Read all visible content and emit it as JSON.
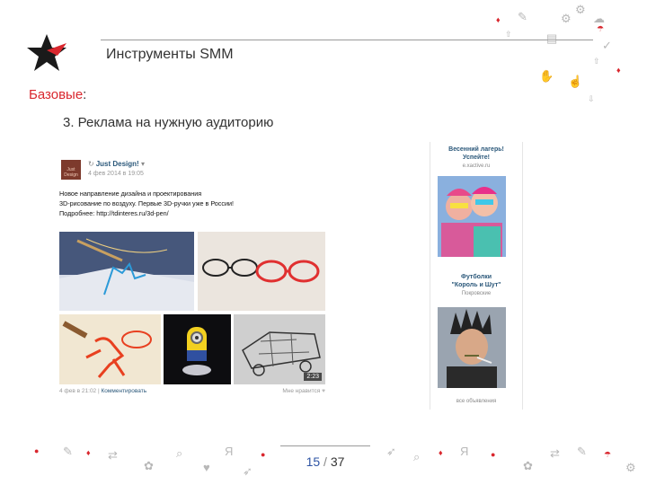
{
  "header": {
    "title": "Инструменты SMM"
  },
  "section": {
    "title": "Базовые",
    "colon": ":"
  },
  "subtitle": "3. Реклама на нужную аудиторию",
  "post": {
    "avatar_text": "Just Design",
    "group_name": "Just Design!",
    "date": "4 фев 2014 в 19:05",
    "text_lines": [
      "Новое направление дизайна и проектирования",
      "3D-рисование по воздуху. Первые 3D-ручки уже в России!",
      "Подробнее: http://tdinteres.ru/3d-pen/"
    ],
    "video_duration": "2:23",
    "footer_date": "4 фев в 21:02",
    "comment_link": "Комментировать",
    "like_text": "Мне нравится"
  },
  "ads": {
    "items": [
      {
        "title_line1": "Весенний лагерь!",
        "title_line2": "Успейте!",
        "site": "e.xactive.ru"
      },
      {
        "title_line1": "Футболки",
        "title_line2": "\"Король и Шут\"",
        "site": "Покровские"
      }
    ],
    "all_ads": "все объявления"
  },
  "pagination": {
    "current": "15",
    "separator": "/",
    "total": "37"
  },
  "colors": {
    "accent_red": "#d9272e",
    "page_blue": "#2e54a4",
    "vk_link": "#2b587a"
  }
}
